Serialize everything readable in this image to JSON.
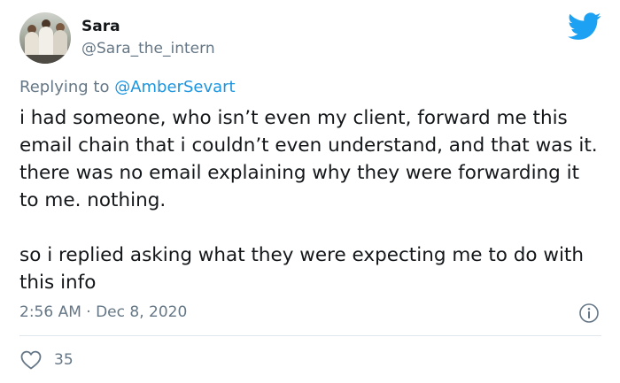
{
  "author": {
    "display_name": "Sara",
    "handle": "@Sara_the_intern",
    "avatar_icon": "profile-photo"
  },
  "reply": {
    "prefix": "Replying to ",
    "mention": "@AmberSevart"
  },
  "tweet": {
    "paragraphs": [
      "i had someone, who isn’t even my client, forward me this email chain that i couldn’t even understand, and that was it. there was no email explaining why they were forwarding it to me. nothing.",
      "so i replied asking what they were expecting me to do with this info"
    ],
    "timestamp": "2:56 AM · Dec 8, 2020"
  },
  "actions": {
    "like_icon": "heart-icon",
    "like_count": "35",
    "info_icon": "info-icon"
  },
  "brand": {
    "logo_icon": "twitter-bird-icon",
    "accent_color": "#1da1f2",
    "link_color": "#1b95e0",
    "secondary_text_color": "#657786"
  }
}
